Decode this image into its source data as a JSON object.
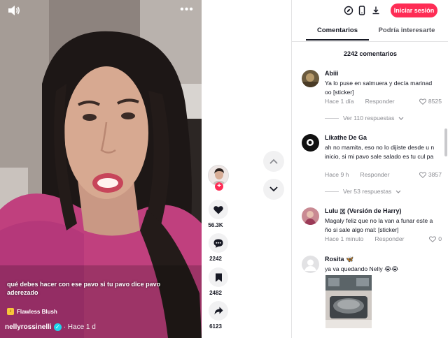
{
  "video": {
    "caption": "qué debes hacer con ese pavo si tu pavo dice pavo aderezado",
    "music": "Flawless Blush",
    "author": "nellyrossinelli",
    "posted": "· Hace 1 d",
    "more_label": "•••"
  },
  "actions": {
    "follow_label": "+",
    "likes": "56.3K",
    "comments": "2242",
    "saves": "2482",
    "shares": "6123"
  },
  "header": {
    "login_label": "Iniciar sesión",
    "tabs": [
      "Comentarios",
      "Podría interesarte"
    ],
    "comment_count": "2242 comentarios"
  },
  "comments": [
    {
      "user": "Abiii",
      "text": "Ya lo puse en salmuera y decía marinad oo [sticker]",
      "time": "Hace 1 día",
      "reply_label": "Responder",
      "likes": "8525",
      "replies": "Ver 110 respuestas"
    },
    {
      "user": "Likathe De Ga",
      "text": "ah no mamita, eso no lo dijiste desde u n inicio, si mi pavo sale salado es tu cul pa",
      "time": "Hace 9 h",
      "reply_label": "Responder",
      "likes": "3857",
      "replies": "Ver 53 respuestas"
    },
    {
      "user": "Lulu 🇽 (Versión de Harry)",
      "text": "Magaly feliz que no la van a funar este a ño si sale algo mal: [sticker]",
      "time": "Hace 1 minuto",
      "reply_label": "Responder",
      "likes": "0"
    },
    {
      "user": "Rosita 🦋",
      "text": "ya va quedando Nelly 😭😭"
    }
  ],
  "colors": {
    "accent": "#fe2c55",
    "text": "#161823",
    "muted": "#8a8b91",
    "action_bg": "#f1f1f2"
  }
}
